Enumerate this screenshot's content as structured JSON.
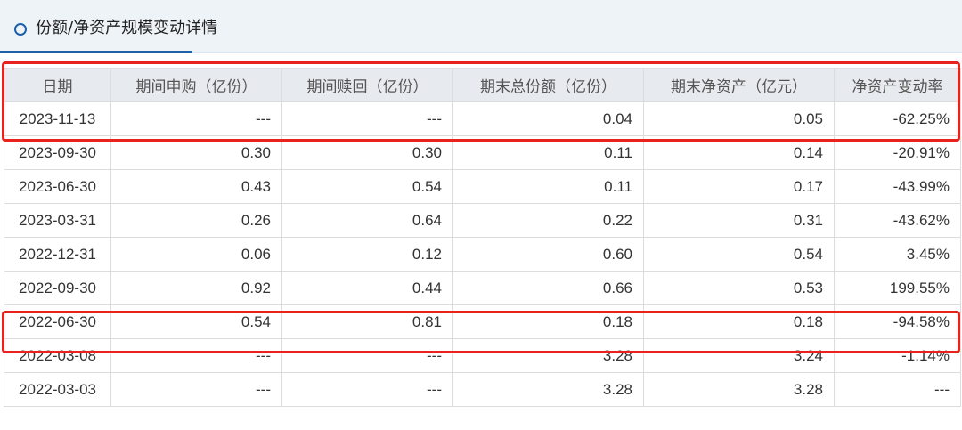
{
  "title": "份额/净资产规模变动详情",
  "colors": {
    "accent": "#1f5fa8",
    "highlight": "#e8231d",
    "header_bg": "#e7eaee",
    "title_bg": "#eef3f8"
  },
  "table": {
    "headers": [
      "日期",
      "期间申购（亿份）",
      "期间赎回（亿份）",
      "期末总份额（亿份）",
      "期末净资产（亿元）",
      "净资产变动率"
    ],
    "rows": [
      [
        "2023-11-13",
        "---",
        "---",
        "0.04",
        "0.05",
        "-62.25%"
      ],
      [
        "2023-09-30",
        "0.30",
        "0.30",
        "0.11",
        "0.14",
        "-20.91%"
      ],
      [
        "2023-06-30",
        "0.43",
        "0.54",
        "0.11",
        "0.17",
        "-43.99%"
      ],
      [
        "2023-03-31",
        "0.26",
        "0.64",
        "0.22",
        "0.31",
        "-43.62%"
      ],
      [
        "2022-12-31",
        "0.06",
        "0.12",
        "0.60",
        "0.54",
        "3.45%"
      ],
      [
        "2022-09-30",
        "0.92",
        "0.44",
        "0.66",
        "0.53",
        "199.55%"
      ],
      [
        "2022-06-30",
        "0.54",
        "0.81",
        "0.18",
        "0.18",
        "-94.58%"
      ],
      [
        "2022-03-08",
        "---",
        "---",
        "3.28",
        "3.24",
        "-1.14%"
      ],
      [
        "2022-03-03",
        "---",
        "---",
        "3.28",
        "3.28",
        "---"
      ]
    ]
  }
}
